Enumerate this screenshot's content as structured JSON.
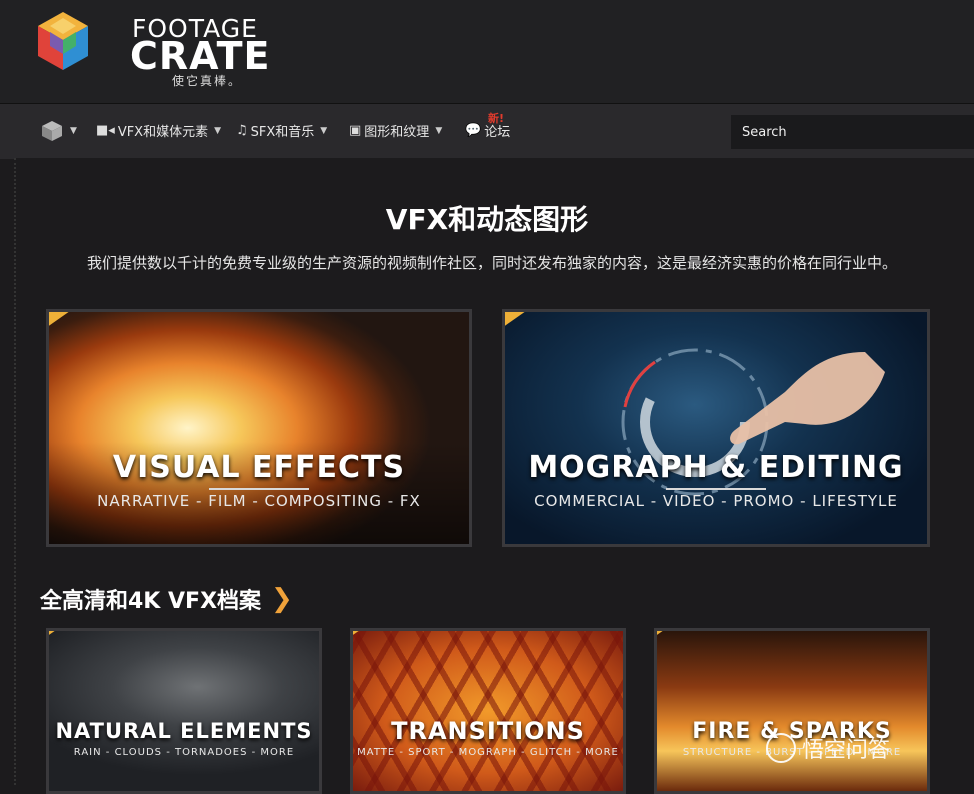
{
  "header": {
    "logo_word1": "FOOTAGE",
    "logo_word2": "CRATE",
    "logo_tagline": "使它真棒。"
  },
  "nav": {
    "items": [
      {
        "label": "",
        "icon": "crate-icon"
      },
      {
        "label": "VFX和媒体元素",
        "icon": "video-camera-icon"
      },
      {
        "label": "SFX和音乐",
        "icon": "music-note-icon"
      },
      {
        "label": "图形和纹理",
        "icon": "image-icon"
      },
      {
        "label": "论坛",
        "icon": "chat-bubbles-icon"
      }
    ],
    "new_badge": "新!",
    "search_placeholder": "Search"
  },
  "hero": {
    "title": "VFX和动态图形",
    "subtitle": "我们提供数以千计的免费专业级的生产资源的视频制作社区，同时还发布独家的内容，这是最经济实惠的价格在同行业中。"
  },
  "big_cards": [
    {
      "title": "VISUAL EFFECTS",
      "sub": "NARRATIVE - FILM - COMPOSITING - FX"
    },
    {
      "title": "MOGRAPH & EDITING",
      "sub": "COMMERCIAL - VIDEO - PROMO - LIFESTYLE"
    }
  ],
  "section": {
    "heading": "全高清和4K VFX档案",
    "arrow": "❯"
  },
  "small_cards": [
    {
      "title": "NATURAL ELEMENTS",
      "sub": "RAIN - CLOUDS - TORNADOES - MORE"
    },
    {
      "title": "TRANSITIONS",
      "sub": "MATTE - SPORT - MOGRAPH - GLITCH - MORE"
    },
    {
      "title": "FIRE & SPARKS",
      "sub": "STRUCTURE - BURST - SPEED - MORE"
    }
  ],
  "watermark": "悟空问答",
  "colors": {
    "accent": "#eeb038",
    "arrow": "#f0a23a",
    "badge": "#e23b2d"
  }
}
